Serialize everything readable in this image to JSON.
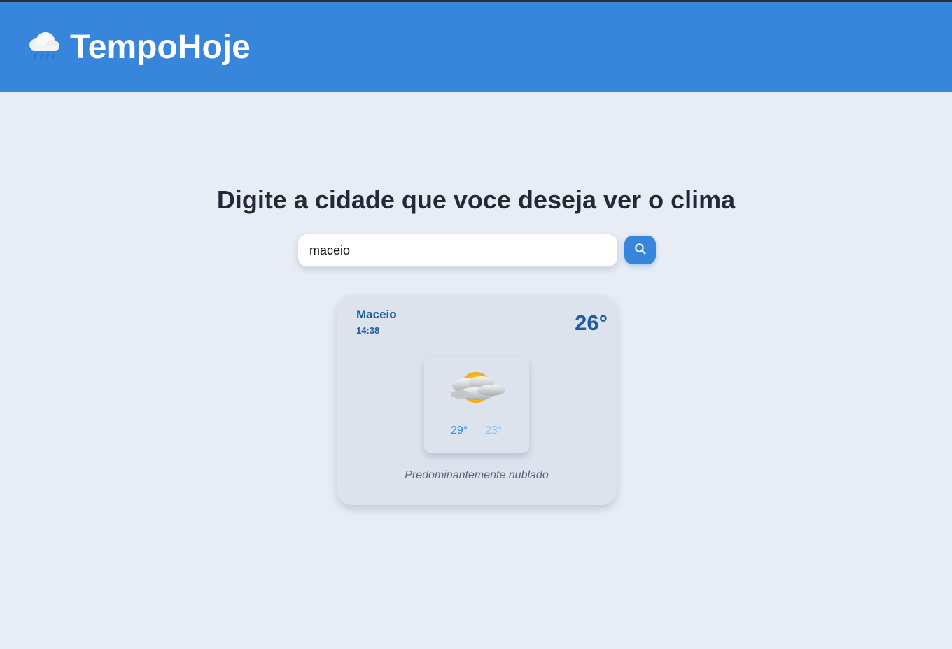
{
  "app": {
    "title": "TempoHoje",
    "logo_icon": "cloud-rain-icon"
  },
  "main": {
    "heading": "Digite a cidade que voce deseja ver o clima"
  },
  "search": {
    "value": "maceio",
    "button_icon": "search-icon"
  },
  "weather": {
    "city": "Maceio",
    "time": "14:38",
    "temperature": "26°",
    "icon": "partly-cloudy-icon",
    "max": "29°",
    "min": "23°",
    "description": "Predominantemente nublado"
  },
  "colors": {
    "brand": "#3786dc",
    "background": "#e8edf5",
    "card": "#dde3ed",
    "accent_text": "#1f5aa8"
  }
}
